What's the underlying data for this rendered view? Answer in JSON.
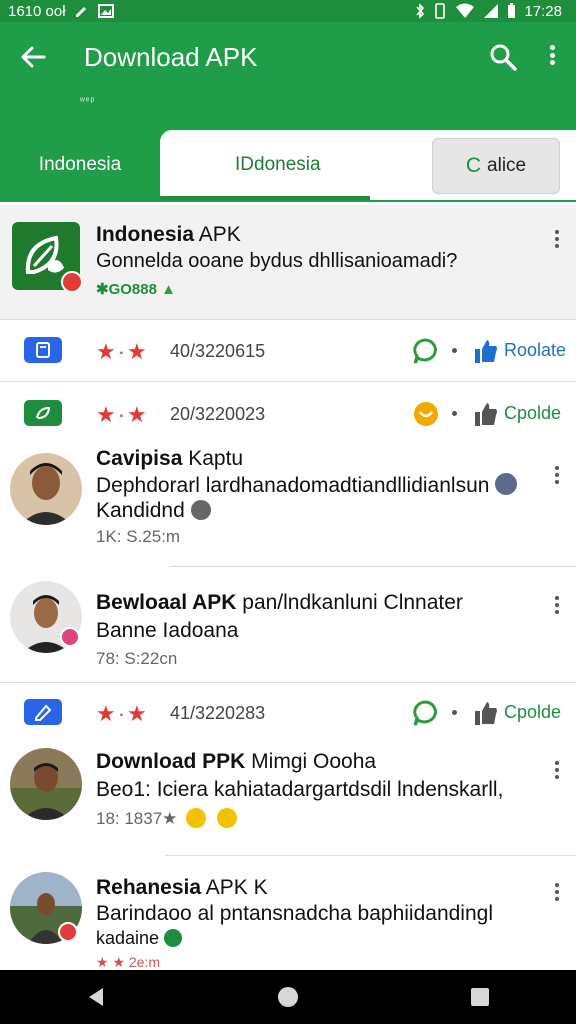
{
  "status_bar": {
    "time_left": "1610 ooł",
    "time_right": "17:28"
  },
  "app_bar": {
    "title": "Download APK",
    "tiny_text": "ʷᵉᵖ"
  },
  "tabs": [
    {
      "label": "Indonesia"
    },
    {
      "label": "IDdonesia"
    },
    {
      "label": "alice",
      "prefix": "C"
    }
  ],
  "featured": {
    "title_bold": "Indonesia",
    "title_rest": " APK",
    "subtitle": "Gonnelda ooane bydus dhllisanioamadi?",
    "tag": "✱GO888"
  },
  "rating_rows": [
    {
      "date": "40/3220615",
      "action": "Roolate",
      "chip_color": "#2a64e8",
      "react_color": "#2e9d3a",
      "thumb_color": "#1f6fd0",
      "action_color": "#1f6fd0"
    },
    {
      "date": "20/3220023",
      "action": "Cpolde",
      "chip_color": "#1e8e3e",
      "react_color": "#f2a900",
      "thumb_color": "#555555",
      "action_color": "#1e8e3e"
    },
    {
      "date": "41/3220283",
      "action": "Cpolde",
      "chip_color": "#2a64e8",
      "react_color": "#2e9d3a",
      "thumb_color": "#555555",
      "action_color": "#1e8e3e"
    }
  ],
  "comments": [
    {
      "name_bold": "Cavipisa",
      "name_rest": " Kaptu",
      "line1": "Dephdorarl lardhanadomadtiandllidianlsun",
      "line2": "Kandidnd",
      "meta": "1K: S.25:m"
    },
    {
      "name_bold": "Bewloaal APK",
      "name_rest": " pan/lndkanluni Clnnater",
      "line1": "Banne Iadoana",
      "line2": "",
      "meta": "78: S:22cn"
    },
    {
      "name_bold": "Download PPK",
      "name_rest": " Mimgi Oooha",
      "line1": "Beo1: Iciera kahiatadargartdsdil lndenskarll,",
      "line2": "",
      "meta": "18: 1837★"
    },
    {
      "name_bold": "Rehanesia",
      "name_rest": " APK K",
      "line1": "Barindaoo al pntansnadcha baphiidandingl",
      "line2": "kadaine",
      "meta": "★ ★ 2e:m"
    }
  ]
}
